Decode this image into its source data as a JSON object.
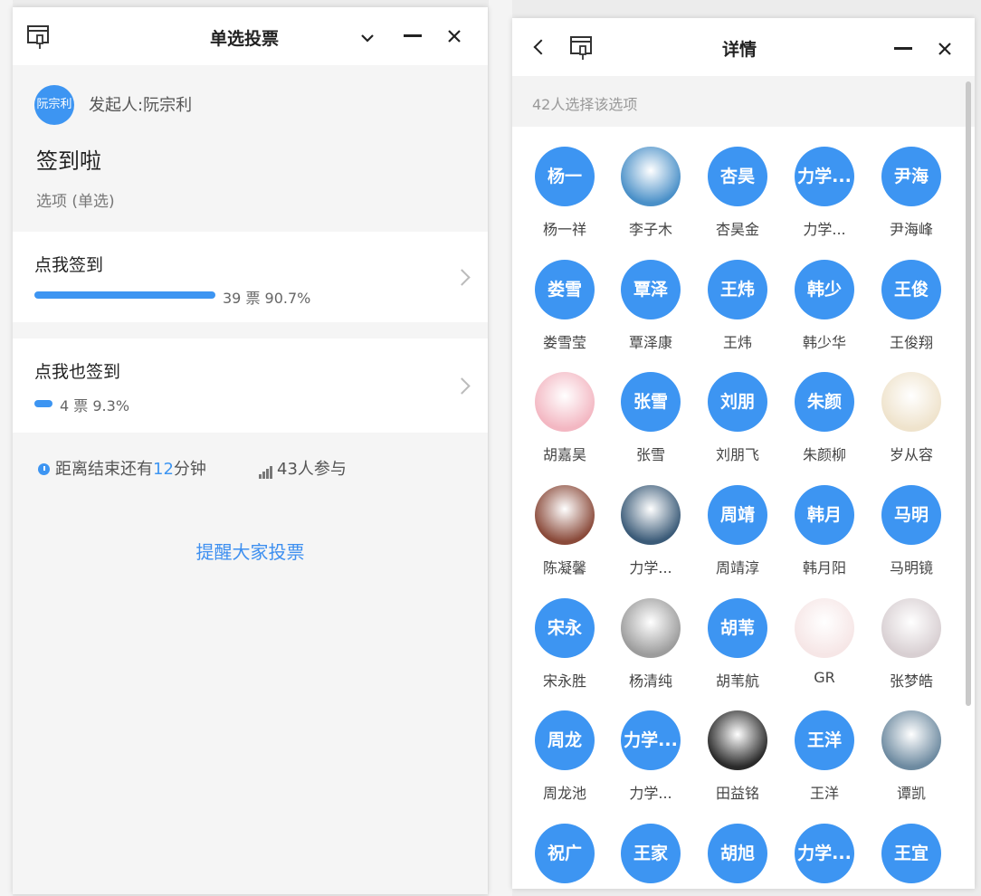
{
  "left_window": {
    "title": "单选投票",
    "initiator_avatar_text": "阮宗利",
    "initiator_label": "发起人:阮宗利",
    "vote_title": "签到啦",
    "vote_type": "选项 (单选)",
    "options": [
      {
        "label": "点我签到",
        "votes_text": "39 票",
        "percent_text": "90.7%",
        "share": 0.907
      },
      {
        "label": "点我也签到",
        "votes_text": "4 票",
        "percent_text": "9.3%",
        "share": 0.093
      }
    ],
    "deadline_prefix": "距离结束还有",
    "deadline_number": "12",
    "deadline_suffix": "分钟",
    "participants": "43人参与",
    "remind_button": "提醒大家投票"
  },
  "right_window": {
    "title": "详情",
    "count_text": "42人选择该选项",
    "voters": [
      {
        "avatar": "杨一",
        "name": "杨一祥",
        "photo": false
      },
      {
        "avatar": "",
        "name": "李子木",
        "photo": true,
        "photo_color": "#4a90c8"
      },
      {
        "avatar": "杏昊",
        "name": "杏昊金",
        "photo": false
      },
      {
        "avatar": "力学...",
        "name": "力学...",
        "photo": false
      },
      {
        "avatar": "尹海",
        "name": "尹海峰",
        "photo": false
      },
      {
        "avatar": "娄雪",
        "name": "娄雪莹",
        "photo": false
      },
      {
        "avatar": "覃泽",
        "name": "覃泽康",
        "photo": false
      },
      {
        "avatar": "王炜",
        "name": "王炜",
        "photo": false
      },
      {
        "avatar": "韩少",
        "name": "韩少华",
        "photo": false
      },
      {
        "avatar": "王俊",
        "name": "王俊翔",
        "photo": false
      },
      {
        "avatar": "",
        "name": "胡嘉昊",
        "photo": true,
        "photo_color": "#f3b7c2"
      },
      {
        "avatar": "张雪",
        "name": "张雪",
        "photo": false
      },
      {
        "avatar": "刘朋",
        "name": "刘朋飞",
        "photo": false
      },
      {
        "avatar": "朱颜",
        "name": "朱颜柳",
        "photo": false
      },
      {
        "avatar": "",
        "name": "岁从容",
        "photo": true,
        "photo_color": "#efe3cc"
      },
      {
        "avatar": "",
        "name": "陈凝馨",
        "photo": true,
        "photo_color": "#8a4a3a"
      },
      {
        "avatar": "",
        "name": "力学...",
        "photo": true,
        "photo_color": "#3b5b78"
      },
      {
        "avatar": "周靖",
        "name": "周靖淳",
        "photo": false
      },
      {
        "avatar": "韩月",
        "name": "韩月阳",
        "photo": false
      },
      {
        "avatar": "马明",
        "name": "马明镜",
        "photo": false
      },
      {
        "avatar": "宋永",
        "name": "宋永胜",
        "photo": false
      },
      {
        "avatar": "",
        "name": "杨清纯",
        "photo": true,
        "photo_color": "#9c9c9c"
      },
      {
        "avatar": "胡苇",
        "name": "胡苇航",
        "photo": false
      },
      {
        "avatar": "",
        "name": "GR",
        "photo": true,
        "photo_color": "#f6e6e6"
      },
      {
        "avatar": "",
        "name": "张梦皓",
        "photo": true,
        "photo_color": "#d8cfd2"
      },
      {
        "avatar": "周龙",
        "name": "周龙池",
        "photo": false
      },
      {
        "avatar": "力学...",
        "name": "力学...",
        "photo": false
      },
      {
        "avatar": "",
        "name": "田益铭",
        "photo": true,
        "photo_color": "#2a2a2a"
      },
      {
        "avatar": "王洋",
        "name": "王洋",
        "photo": false
      },
      {
        "avatar": "",
        "name": "谭凯",
        "photo": true,
        "photo_color": "#6d8aa0"
      },
      {
        "avatar": "祝广",
        "name": "",
        "photo": false
      },
      {
        "avatar": "王家",
        "name": "",
        "photo": false
      },
      {
        "avatar": "胡旭",
        "name": "",
        "photo": false
      },
      {
        "avatar": "力学...",
        "name": "",
        "photo": false
      },
      {
        "avatar": "王宜",
        "name": "",
        "photo": false
      }
    ]
  },
  "colors": {
    "accent": "#3d95f2",
    "link": "#3d8ff0",
    "panel_bg": "#f5f5f5"
  },
  "icons": [
    "pin-window-icon",
    "chevron-down-icon",
    "minimize-icon",
    "close-icon",
    "chevron-right-icon",
    "back-chevron-icon",
    "clock-icon",
    "bar-chart-icon"
  ]
}
